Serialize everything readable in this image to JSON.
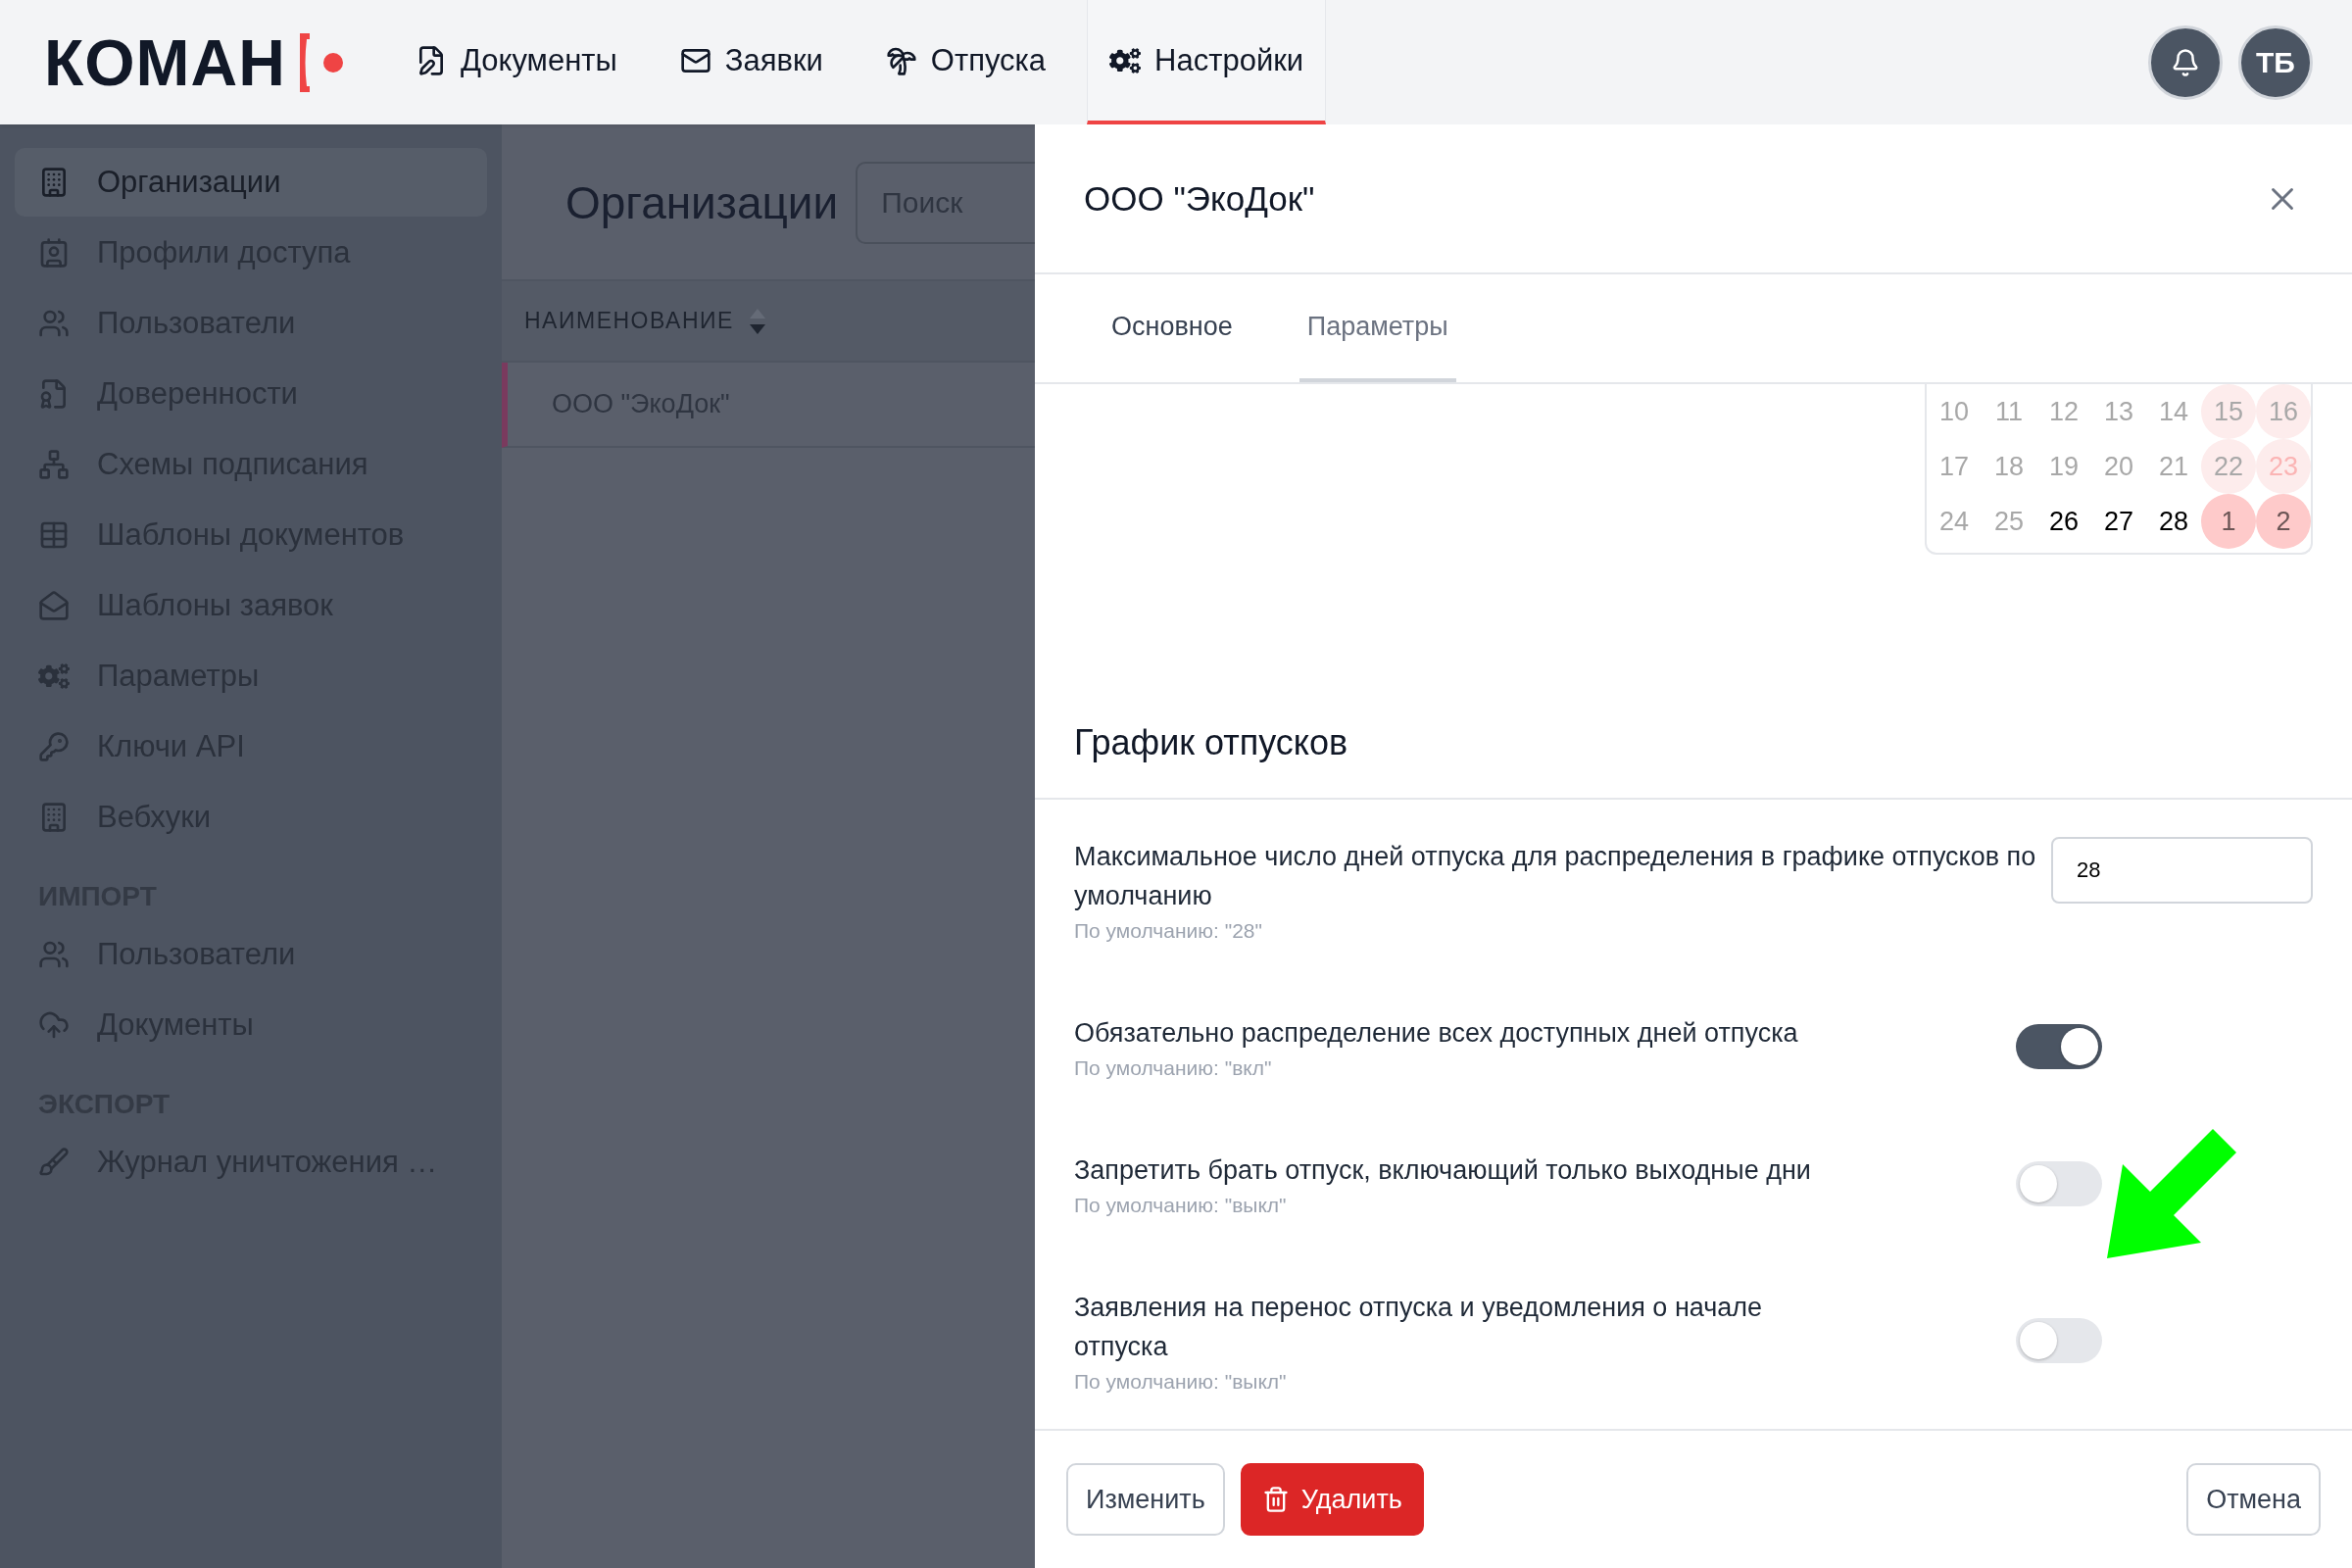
{
  "header": {
    "logo": "КОМАН",
    "nav": [
      {
        "label": "Документы",
        "selected": false
      },
      {
        "label": "Заявки",
        "selected": false
      },
      {
        "label": "Отпуска",
        "selected": false
      },
      {
        "label": "Настройки",
        "selected": true
      }
    ],
    "avatar": "ТБ"
  },
  "sidebar": {
    "sections": [
      {
        "items": [
          {
            "label": "Организации",
            "selected": true
          },
          {
            "label": "Профили доступа",
            "selected": false
          },
          {
            "label": "Пользователи",
            "selected": false
          },
          {
            "label": "Доверенности",
            "selected": false
          },
          {
            "label": "Схемы подписания",
            "selected": false
          },
          {
            "label": "Шаблоны документов",
            "selected": false
          },
          {
            "label": "Шаблоны заявок",
            "selected": false
          },
          {
            "label": "Параметры",
            "selected": false
          },
          {
            "label": "Ключи API",
            "selected": false
          },
          {
            "label": "Вебхуки",
            "selected": false
          }
        ]
      },
      {
        "title": "ИМПОРТ",
        "items": [
          {
            "label": "Пользователи",
            "selected": false
          },
          {
            "label": "Документы",
            "selected": false
          }
        ]
      },
      {
        "title": "ЭКСПОРТ",
        "items": [
          {
            "label": "Журнал уничтожения …",
            "selected": false
          }
        ]
      }
    ]
  },
  "page": {
    "title": "Организации",
    "search": {
      "placeholder": "Поиск"
    },
    "table": {
      "columns": [
        {
          "label": "НАИМЕНОВАНИЕ",
          "sort_descending": true
        }
      ],
      "rows": [
        {
          "name": "ООО \"ЭкоДок\"",
          "selected": true
        }
      ]
    }
  },
  "drawer": {
    "title": "ООО \"ЭкоДок\"",
    "tabs": [
      {
        "label": "Основное",
        "selected": false
      },
      {
        "label": "Параметры",
        "selected": true
      }
    ],
    "calendar": {
      "weeks": [
        {
          "days": [
            {
              "label": "10",
              "disabled": true,
              "kind": "workday"
            },
            {
              "label": "11",
              "disabled": true,
              "kind": "workday"
            },
            {
              "label": "12",
              "disabled": true,
              "kind": "workday"
            },
            {
              "label": "13",
              "disabled": true,
              "kind": "workday"
            },
            {
              "label": "14",
              "disabled": true,
              "kind": "workday"
            },
            {
              "label": "15",
              "disabled": true,
              "kind": "weekend"
            },
            {
              "label": "16",
              "disabled": true,
              "kind": "weekend"
            }
          ]
        },
        {
          "days": [
            {
              "label": "17",
              "disabled": true,
              "kind": "workday"
            },
            {
              "label": "18",
              "disabled": true,
              "kind": "workday"
            },
            {
              "label": "19",
              "disabled": true,
              "kind": "workday"
            },
            {
              "label": "20",
              "disabled": true,
              "kind": "workday"
            },
            {
              "label": "21",
              "disabled": true,
              "kind": "workday"
            },
            {
              "label": "22",
              "disabled": true,
              "kind": "weekend"
            },
            {
              "label": "23",
              "disabled": true,
              "kind": "holiday"
            }
          ]
        },
        {
          "days": [
            {
              "label": "24",
              "disabled": true,
              "kind": "workday"
            },
            {
              "label": "25",
              "disabled": true,
              "kind": "workday"
            },
            {
              "label": "26",
              "disabled": false,
              "kind": "workday"
            },
            {
              "label": "27",
              "disabled": false,
              "kind": "workday"
            },
            {
              "label": "28",
              "disabled": false,
              "kind": "workday"
            },
            {
              "label": "1",
              "disabled": false,
              "kind": "weekend"
            },
            {
              "label": "2",
              "disabled": false,
              "kind": "weekend"
            }
          ]
        }
      ]
    },
    "section_title": "График отпусков",
    "settings": [
      {
        "kind": "number",
        "label": "Максимальное число дней отпуска для распределения в графике отпусков по умолчанию",
        "hint": "По умолчанию: \"28\"",
        "value": "28"
      },
      {
        "kind": "toggle",
        "label": "Обязательно распределение всех доступных дней отпуска",
        "hint": "По умолчанию: \"вкл\"",
        "on": true
      },
      {
        "kind": "toggle",
        "label": "Запретить брать отпуск, включающий только выходные дни",
        "hint": "По умолчанию: \"выкл\"",
        "on": false
      },
      {
        "kind": "toggle",
        "label": "Заявления на перенос отпуска и уведомления о начале отпуска",
        "hint": "По умолчанию: \"выкл\"",
        "on": false
      }
    ],
    "buttons": [
      {
        "label": "Изменить",
        "kind": "secondary"
      },
      {
        "label": "Удалить",
        "kind": "danger"
      },
      {
        "label": "Отмена",
        "kind": "cancel"
      }
    ]
  }
}
